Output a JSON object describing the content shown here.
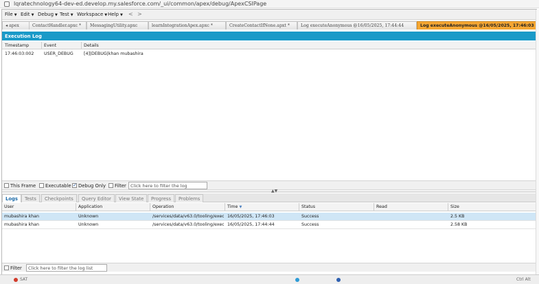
{
  "browser": {
    "url": "lqratechnology64-dev-ed.develop.my.salesforce.com/_ui/common/apex/debug/ApexCSIPage"
  },
  "menu": {
    "items": [
      "File",
      "Edit",
      "Debug",
      "Test",
      "Workspace",
      "Help"
    ],
    "back": "<",
    "forward": ">"
  },
  "tabs": [
    {
      "label": "apex"
    },
    {
      "label": "ContactHandler.apxc *"
    },
    {
      "label": "MessagingUtility.apxc"
    },
    {
      "label": "learnIntegrationApex.apxc *"
    },
    {
      "label": "CreateContactIfNone.apxt *"
    },
    {
      "label": "Log executeAnonymous @16/05/2025, 17:44:44"
    },
    {
      "label": "Log executeAnonymous @16/05/2025, 17:46:03",
      "active": true
    }
  ],
  "execution_log": {
    "title": "Execution Log",
    "columns": [
      "Timestamp",
      "Event",
      "Details"
    ],
    "rows": [
      {
        "timestamp": "17:46:03:002",
        "event": "USER_DEBUG",
        "details": "[4]|DEBUG|khan mubashira"
      }
    ]
  },
  "filter_bar": {
    "this_frame": "This Frame",
    "executable": "Executable",
    "debug_only": "Debug Only",
    "filter": "Filter",
    "placeholder": "Click here to filter the log"
  },
  "bottom_tabs": [
    "Logs",
    "Tests",
    "Checkpoints",
    "Query Editor",
    "View State",
    "Progress",
    "Problems"
  ],
  "logs_grid": {
    "columns": [
      "User",
      "Application",
      "Operation",
      "Time",
      "Status",
      "Read",
      "Size"
    ],
    "sort_indicator": "▼",
    "rows": [
      {
        "user": "mubashira khan",
        "application": "Unknown",
        "operation": "/services/data/v63.0/tooling/exec...",
        "time": "16/05/2025, 17:46:03",
        "status": "Success",
        "read": "",
        "size": "2.5 KB"
      },
      {
        "user": "mubashira khan",
        "application": "Unknown",
        "operation": "/services/data/v63.0/tooling/exec...",
        "time": "16/05/2025, 17:44:44",
        "status": "Success",
        "read": "",
        "size": "2.58 KB"
      }
    ]
  },
  "bottom_filter": {
    "filter": "Filter",
    "placeholder": "Click here to filter the log list"
  },
  "taskbar": {
    "left_text": "SAT",
    "right_text": "Ctrl Alt"
  },
  "colors": {
    "accent": "#1a9ac8",
    "active_tab": "#f5a733",
    "selected_row": "#cfe6f6"
  }
}
